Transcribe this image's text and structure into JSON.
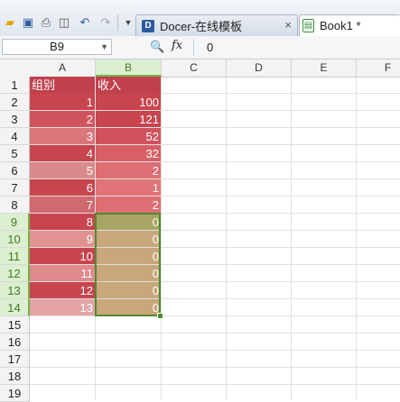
{
  "tabs": [
    {
      "label": "Docer-在线模板",
      "icon": "docer-icon",
      "close": "×"
    },
    {
      "label": "Book1 *",
      "icon": "spreadsheet-icon"
    }
  ],
  "formula_bar": {
    "cell_ref": "B9",
    "fx": "fx",
    "value": "0"
  },
  "columns": [
    "A",
    "B",
    "C",
    "D",
    "E",
    "F"
  ],
  "rows": [
    "1",
    "2",
    "3",
    "4",
    "5",
    "6",
    "7",
    "8",
    "9",
    "10",
    "11",
    "12",
    "13",
    "14",
    "15",
    "16",
    "17",
    "18",
    "19"
  ],
  "selection": {
    "column": "B",
    "rows": [
      "9",
      "10",
      "11",
      "12",
      "13",
      "14"
    ]
  },
  "sheet": {
    "header": [
      "组别",
      "收入"
    ],
    "data": [
      [
        "1",
        "100"
      ],
      [
        "2",
        "121"
      ],
      [
        "3",
        "52"
      ],
      [
        "4",
        "32"
      ],
      [
        "5",
        "2"
      ],
      [
        "6",
        "1"
      ],
      [
        "7",
        "2"
      ],
      [
        "8",
        "0"
      ],
      [
        "9",
        "0"
      ],
      [
        "10",
        "0"
      ],
      [
        "11",
        "0"
      ],
      [
        "12",
        "0"
      ],
      [
        "13",
        "0"
      ]
    ]
  },
  "colors": {
    "header_fill": "#c0414d",
    "col_a_fills": [
      "#c8444e",
      "#d0545d",
      "#d9777c",
      "#c8444e",
      "#d98a8b",
      "#c8444e",
      "#d06a70",
      "#c8444e",
      "#e29293",
      "#c8444e",
      "#df8a8d",
      "#c8444e",
      "#e3a3a5"
    ],
    "col_b_fills": [
      "#c8444e",
      "#c8444e",
      "#d0525d",
      "#d95f66",
      "#de6e73",
      "#e07479",
      "#de6e73",
      "#a8a463",
      "#c8a77c",
      "#c9a67b",
      "#c9a67b",
      "#c8a77c",
      "#c9a67b"
    ],
    "selection_border": "#4f8a2f"
  }
}
